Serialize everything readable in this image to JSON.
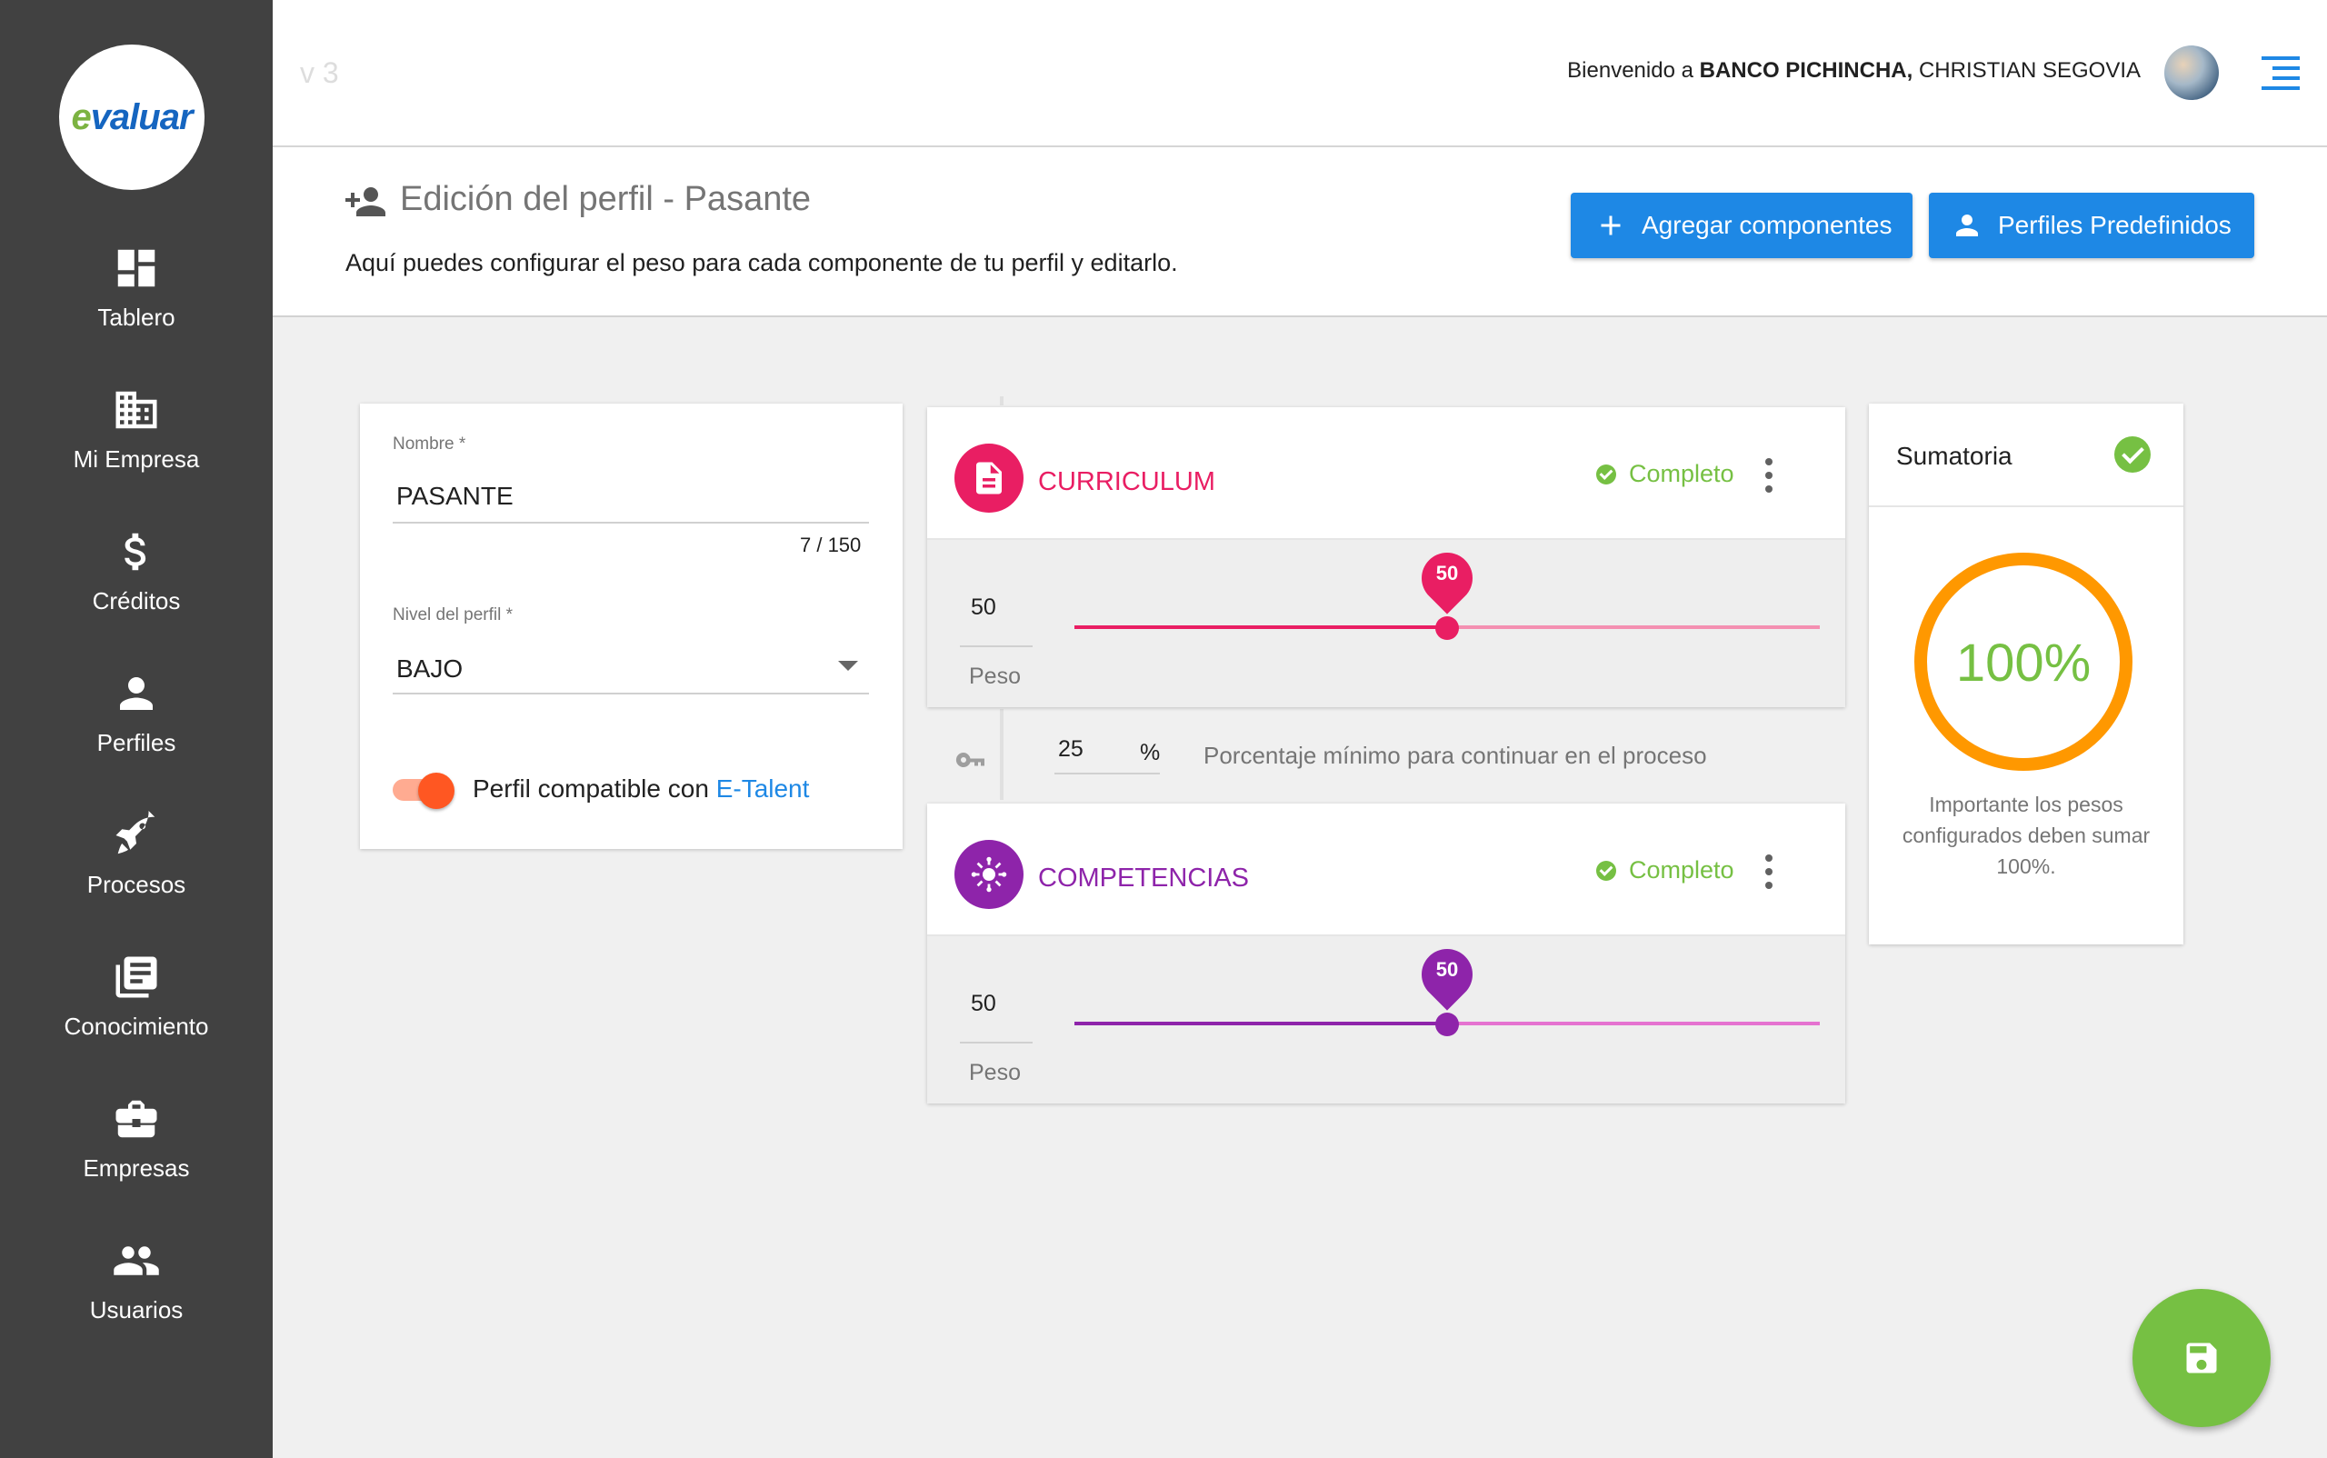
{
  "header": {
    "version": "v 3",
    "welcome_prefix": "Bienvenido a",
    "company": "BANCO PICHINCHA,",
    "user": "CHRISTIAN SEGOVIA"
  },
  "sidebar": {
    "logo_text_e": "e",
    "logo_text_rest": "valuar",
    "items": [
      {
        "label": "Tablero",
        "icon": "dashboard-icon"
      },
      {
        "label": "Mi Empresa",
        "icon": "building-icon"
      },
      {
        "label": "Créditos",
        "icon": "dollar-icon"
      },
      {
        "label": "Perfiles",
        "icon": "person-icon"
      },
      {
        "label": "Procesos",
        "icon": "rocket-icon"
      },
      {
        "label": "Conocimiento",
        "icon": "library-icon"
      },
      {
        "label": "Empresas",
        "icon": "briefcase-icon"
      },
      {
        "label": "Usuarios",
        "icon": "group-icon"
      }
    ]
  },
  "page": {
    "title": "Edición del perfil - Pasante",
    "subtitle": "Aquí puedes configurar el peso para cada componente de tu perfil y editarlo.",
    "btn_add": "Agregar componentes",
    "btn_pred": "Perfiles Predefinidos"
  },
  "profile": {
    "name_label": "Nombre *",
    "name_value": "PASANTE",
    "name_counter": "7 / 150",
    "level_label": "Nivel del perfil *",
    "level_value": "BAJO",
    "switch_text": "Perfil compatible con",
    "switch_link": "E-Talent",
    "switch_on": true
  },
  "components": [
    {
      "title": "CURRICULUM",
      "status": "Completo",
      "weight": "50",
      "weight_label": "Peso",
      "pin": "50",
      "slider_value": 50,
      "color": "#e91e63",
      "track_light": "#f48fb1",
      "icon": "document-icon"
    },
    {
      "title": "COMPETENCIAS",
      "status": "Completo",
      "weight": "50",
      "weight_label": "Peso",
      "pin": "50",
      "slider_value": 50,
      "color": "#8e24aa",
      "track_light": "#e572d0",
      "icon": "competencies-icon"
    }
  ],
  "min_pct": {
    "value": "25",
    "unit": "%",
    "text": "Porcentaje mínimo para continuar en el proceso"
  },
  "summary": {
    "title": "Sumatoria",
    "percent": "100%",
    "note": "Importante los pesos configurados deben sumar 100%."
  },
  "colors": {
    "primary": "#1e88e5",
    "success": "#76c043",
    "ring": "#ff9800",
    "sidebar": "#414141"
  }
}
